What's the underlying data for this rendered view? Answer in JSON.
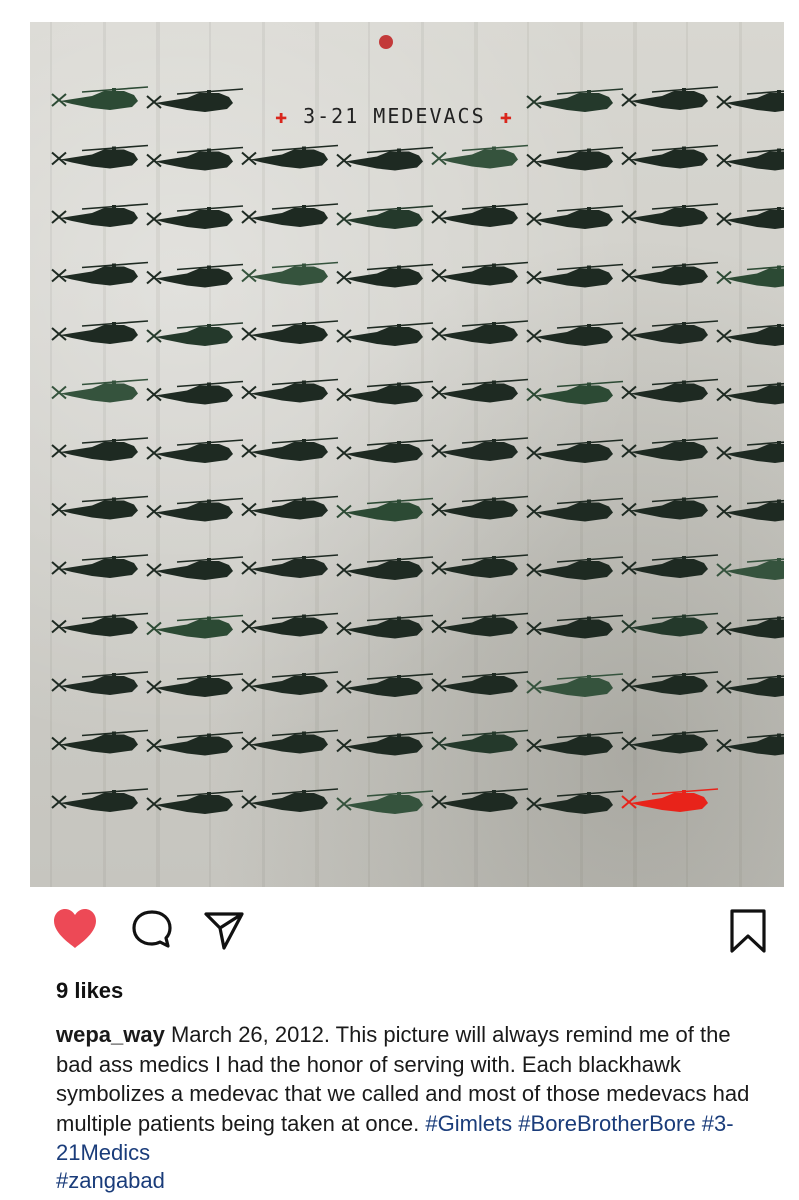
{
  "photo": {
    "wall_title": "3-21 MEDEVACS",
    "cross_symbol": "✚",
    "description_icon": "helicopter-icon",
    "highlight_color": "#e8231a",
    "helicopter_color": "#1e2a22"
  },
  "actions": {
    "like_icon": "heart-icon",
    "like_color": "#ed4956",
    "comment_icon": "comment-icon",
    "share_icon": "share-icon",
    "save_icon": "bookmark-icon"
  },
  "post": {
    "likes": "9 likes",
    "username": "wepa_way",
    "caption_text": " March 26, 2012.  This picture will always remind me of the bad ass medics I had the honor of serving with. Each blackhawk symbolizes a medevac that we called and most of those medevacs had multiple patients being taken at once. ",
    "tags": [
      "#Gimlets",
      "#BoreBrotherBore",
      "#3-21Medics"
    ],
    "cut_tag": "#zangabad"
  }
}
